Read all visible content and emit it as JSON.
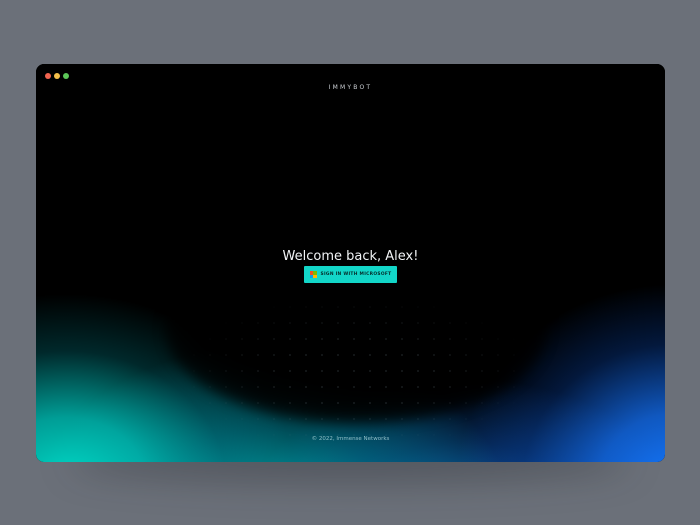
{
  "window": {
    "controls": [
      {
        "name": "close",
        "color": "#f0634f"
      },
      {
        "name": "minimize",
        "color": "#f5c04a"
      },
      {
        "name": "maximize",
        "color": "#5cc658"
      }
    ]
  },
  "header": {
    "brand": "IMMYBOT"
  },
  "main": {
    "welcome_text": "Welcome back, Alex!",
    "signin_label": "SIGN IN WITH MICROSOFT",
    "signin_icon": "microsoft-logo-icon"
  },
  "footer": {
    "copyright": "© 2022, Immense Networks"
  },
  "colors": {
    "accent": "#12d6c8",
    "background": "#000000",
    "glow_teal": "#00e6d2",
    "glow_blue": "#1478ff",
    "ms_red": "#f25022",
    "ms_green": "#7fba00",
    "ms_blue": "#00a4ef",
    "ms_yellow": "#ffb900"
  }
}
